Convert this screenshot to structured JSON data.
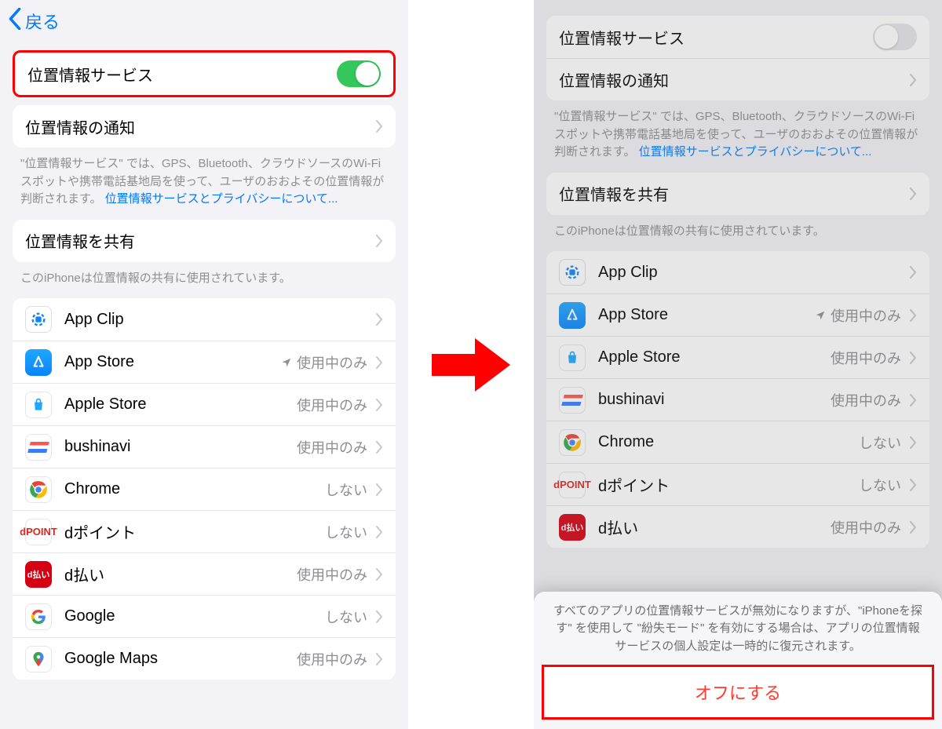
{
  "nav": {
    "back_label": "戻る"
  },
  "left": {
    "location_service_label": "位置情報サービス",
    "location_alerts_label": "位置情報の通知",
    "explain_text": "\"位置情報サービス\" では、GPS、Bluetooth、クラウドソースのWi-Fiスポットや携帯電話基地局を使って、ユーザのおおよその位置情報が判断されます。 ",
    "explain_link": "位置情報サービスとプライバシーについて...",
    "share_label": "位置情報を共有",
    "share_footer": "このiPhoneは位置情報の共有に使用されています。",
    "switch_on": true,
    "apps": [
      {
        "name": "App Clip",
        "status": "",
        "icon": "appclip"
      },
      {
        "name": "App Store",
        "status": "使用中のみ",
        "icon": "appstore",
        "indicator": true
      },
      {
        "name": "Apple Store",
        "status": "使用中のみ",
        "icon": "applestore"
      },
      {
        "name": "bushinavi",
        "status": "使用中のみ",
        "icon": "bushinavi"
      },
      {
        "name": "Chrome",
        "status": "しない",
        "icon": "chrome"
      },
      {
        "name": "dポイント",
        "status": "しない",
        "icon": "dpoint"
      },
      {
        "name": "d払い",
        "status": "使用中のみ",
        "icon": "dbarai"
      },
      {
        "name": "Google",
        "status": "しない",
        "icon": "google"
      },
      {
        "name": "Google Maps",
        "status": "使用中のみ",
        "icon": "gmaps"
      }
    ]
  },
  "right": {
    "location_service_label": "位置情報サービス",
    "location_alerts_label": "位置情報の通知",
    "explain_text": "\"位置情報サービス\" では、GPS、Bluetooth、クラウドソースのWi-Fiスポットや携帯電話基地局を使って、ユーザのおおよその位置情報が判断されます。 ",
    "explain_link": "位置情報サービスとプライバシーについて...",
    "share_label": "位置情報を共有",
    "share_footer": "このiPhoneは位置情報の共有に使用されています。",
    "switch_on": false,
    "apps": [
      {
        "name": "App Clip",
        "status": "",
        "icon": "appclip"
      },
      {
        "name": "App Store",
        "status": "使用中のみ",
        "icon": "appstore",
        "indicator": true
      },
      {
        "name": "Apple Store",
        "status": "使用中のみ",
        "icon": "applestore"
      },
      {
        "name": "bushinavi",
        "status": "使用中のみ",
        "icon": "bushinavi"
      },
      {
        "name": "Chrome",
        "status": "しない",
        "icon": "chrome"
      },
      {
        "name": "dポイント",
        "status": "しない",
        "icon": "dpoint"
      },
      {
        "name": "d払い",
        "status": "使用中のみ",
        "icon": "dbarai"
      }
    ],
    "sheet_msg": "すべてのアプリの位置情報サービスが無効になりますが、\"iPhoneを探す\" を使用して \"紛失モード\" を有効にする場合は、アプリの位置情報サービスの個人設定は一時的に復元されます。",
    "sheet_btn": "オフにする"
  },
  "icons": {
    "dpoint_text": "dPOINT",
    "dbarai_text": "d払い"
  }
}
